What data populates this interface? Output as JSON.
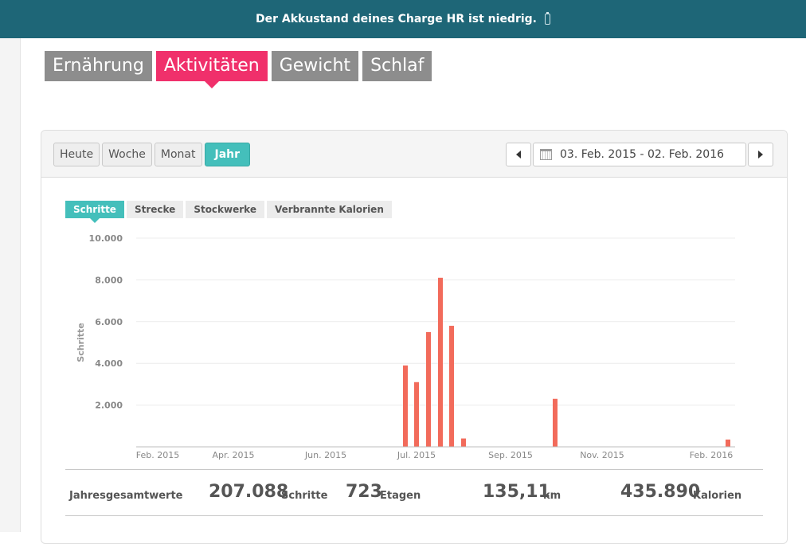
{
  "banner": {
    "text": "Der Akkustand deines Charge HR ist niedrig."
  },
  "nav_tabs": [
    "Ernährung",
    "Aktivitäten",
    "Gewicht",
    "Schlaf"
  ],
  "period_buttons": [
    "Heute",
    "Woche",
    "Monat",
    "Jahr"
  ],
  "date_range": "03. Feb. 2015 - 02. Feb. 2016",
  "metric_tabs": [
    "Schritte",
    "Strecke",
    "Stockwerke",
    "Verbrannte Kalorien"
  ],
  "chart_data": {
    "type": "bar",
    "ylabel": "Schritte",
    "ylim": [
      0,
      10000
    ],
    "yticks": [
      "2.000",
      "4.000",
      "6.000",
      "8.000",
      "10.000"
    ],
    "xticks": [
      "Feb. 2015",
      "Apr. 2015",
      "Jun. 2015",
      "Jul. 2015",
      "Sep. 2015",
      "Nov. 2015",
      "Feb. 2016"
    ],
    "color": "#f26b5b",
    "bars": [
      {
        "week": "Jul. 2015 (1)",
        "value": 3900
      },
      {
        "week": "Jul. 2015 (2)",
        "value": 3100
      },
      {
        "week": "Jul. 2015 (3)",
        "value": 5500
      },
      {
        "week": "Jul. 2015 (4)",
        "value": 8100
      },
      {
        "week": "Aug. 2015 (1)",
        "value": 5800
      },
      {
        "week": "Aug. 2015 (2)",
        "value": 400
      },
      {
        "week": "Okt. 2015",
        "value": 2300
      },
      {
        "week": "Feb. 2016",
        "value": 350
      }
    ]
  },
  "totals": {
    "label": "Jahresgesamtwerte",
    "steps_value": "207.088",
    "steps_unit": "Schritte",
    "floors_value": "723",
    "floors_unit": "Etagen",
    "distance_value": "135,11",
    "distance_unit": "km",
    "calories_value": "435.890",
    "calories_unit": "Kalorien"
  }
}
